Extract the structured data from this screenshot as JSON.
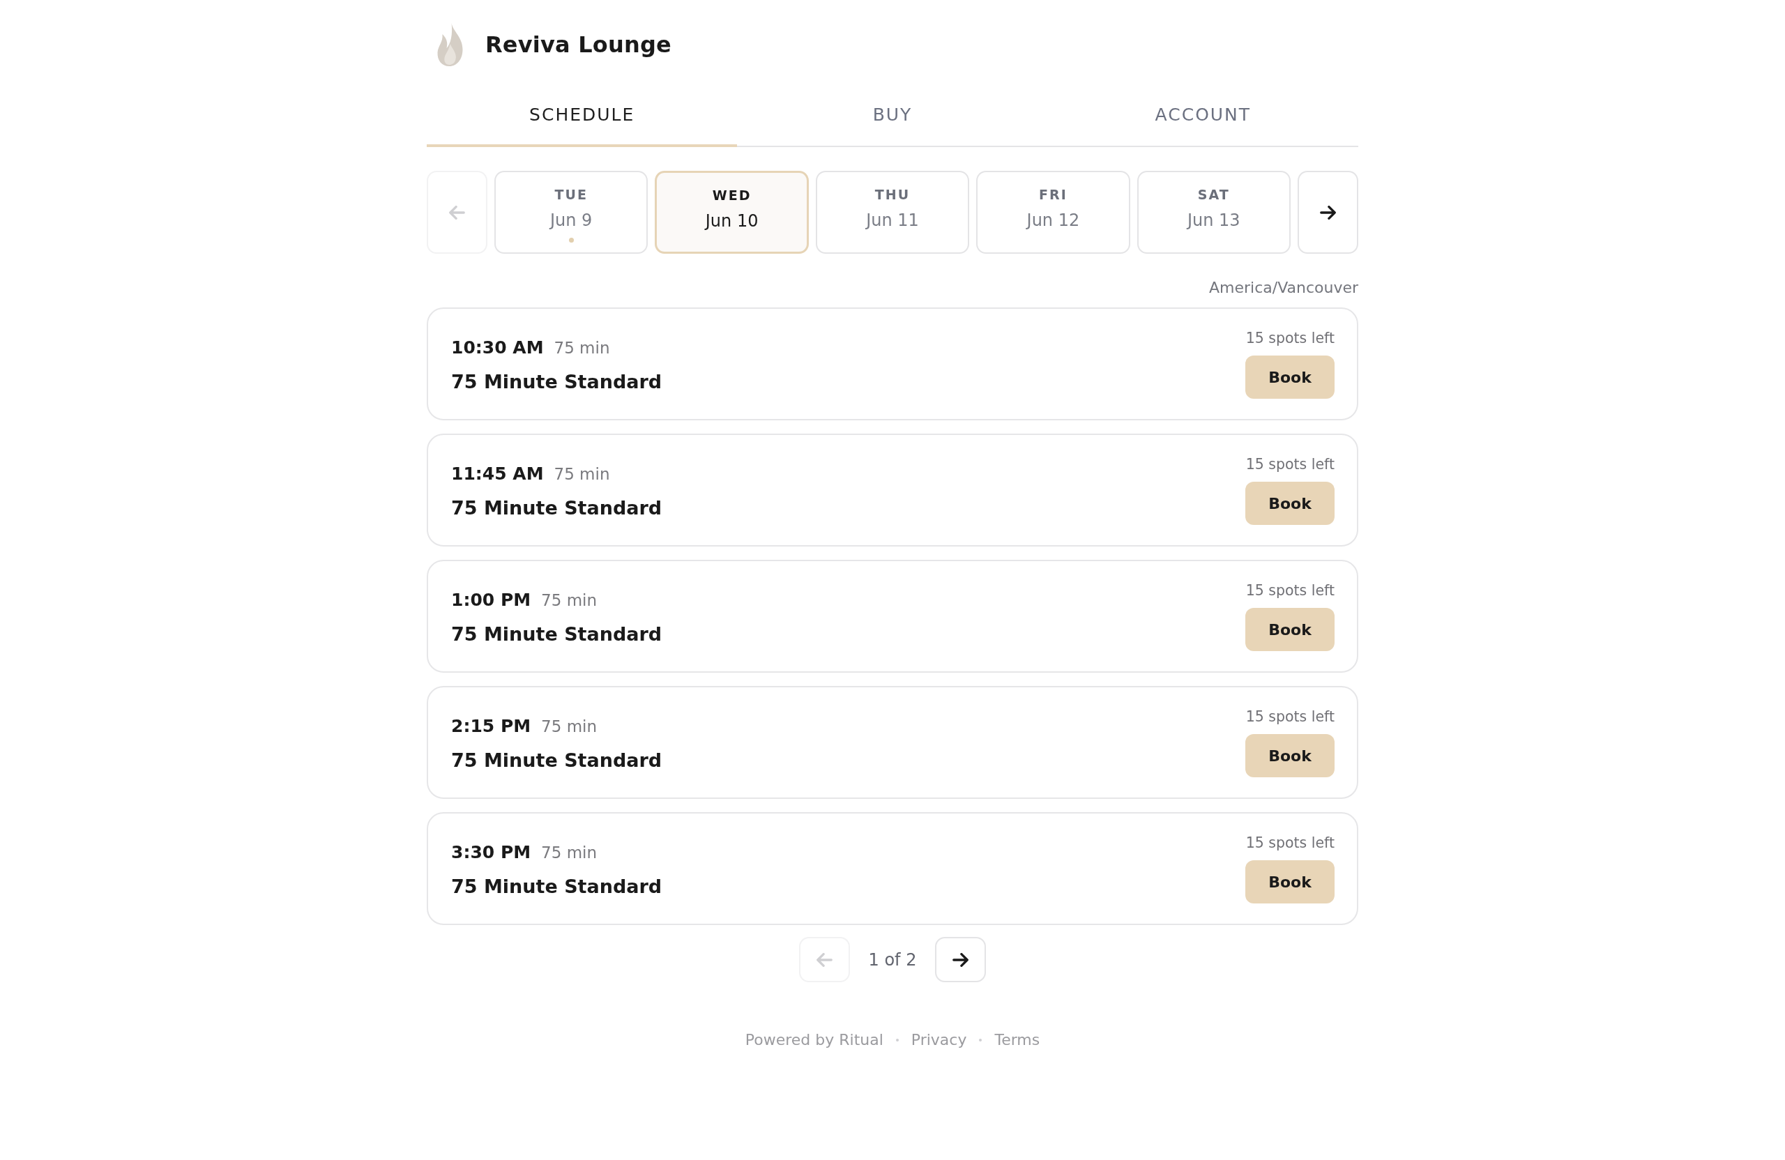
{
  "brand": {
    "name": "Reviva Lounge"
  },
  "tabs": [
    {
      "label": "SCHEDULE",
      "selected": true
    },
    {
      "label": "BUY",
      "selected": false
    },
    {
      "label": "ACCOUNT",
      "selected": false
    }
  ],
  "date_strip": {
    "prev_disabled": true,
    "next_disabled": false,
    "days": [
      {
        "weekday": "TUE",
        "date": "Jun 9",
        "selected": false,
        "marker": true
      },
      {
        "weekday": "WED",
        "date": "Jun 10",
        "selected": true,
        "marker": false
      },
      {
        "weekday": "THU",
        "date": "Jun 11",
        "selected": false,
        "marker": false
      },
      {
        "weekday": "FRI",
        "date": "Jun 12",
        "selected": false,
        "marker": false
      },
      {
        "weekday": "SAT",
        "date": "Jun 13",
        "selected": false,
        "marker": false
      }
    ]
  },
  "timezone": "America/Vancouver",
  "sessions": [
    {
      "time": "10:30 AM",
      "duration": "75 min",
      "title": "75 Minute Standard",
      "spots": "15 spots left",
      "action": "Book"
    },
    {
      "time": "11:45 AM",
      "duration": "75 min",
      "title": "75 Minute Standard",
      "spots": "15 spots left",
      "action": "Book"
    },
    {
      "time": "1:00 PM",
      "duration": "75 min",
      "title": "75 Minute Standard",
      "spots": "15 spots left",
      "action": "Book"
    },
    {
      "time": "2:15 PM",
      "duration": "75 min",
      "title": "75 Minute Standard",
      "spots": "15 spots left",
      "action": "Book"
    },
    {
      "time": "3:30 PM",
      "duration": "75 min",
      "title": "75 Minute Standard",
      "spots": "15 spots left",
      "action": "Book"
    }
  ],
  "pagination": {
    "prev_disabled": true,
    "page": "1 of 2",
    "next_disabled": false
  },
  "footer": {
    "powered_by": "Powered by Ritual",
    "links": [
      "Privacy",
      "Terms"
    ]
  }
}
